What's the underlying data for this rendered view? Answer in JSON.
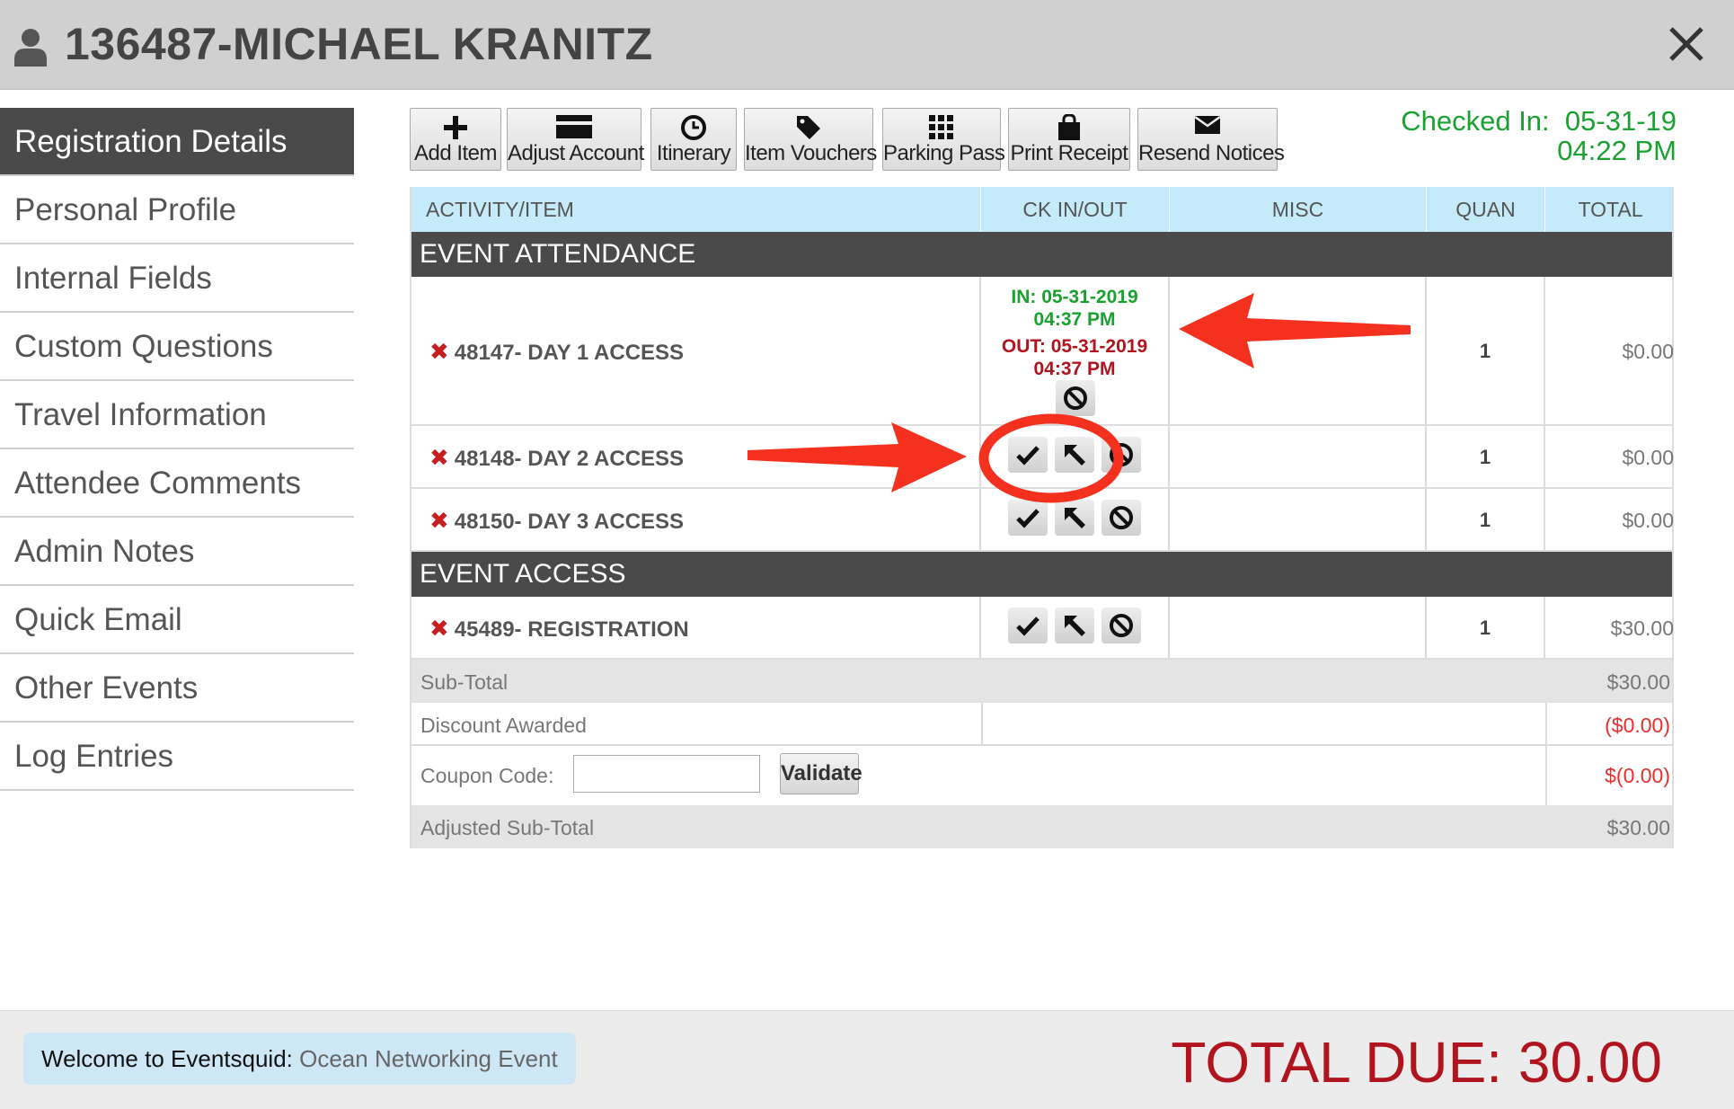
{
  "header": {
    "title": "136487-MICHAEL KRANITZ"
  },
  "sidebar": {
    "items": [
      {
        "label": "Registration Details",
        "active": true
      },
      {
        "label": "Personal Profile"
      },
      {
        "label": "Internal Fields"
      },
      {
        "label": "Custom Questions"
      },
      {
        "label": "Travel Information"
      },
      {
        "label": "Attendee Comments"
      },
      {
        "label": "Admin Notes"
      },
      {
        "label": "Quick Email"
      },
      {
        "label": "Other Events"
      },
      {
        "label": "Log Entries"
      }
    ]
  },
  "toolbar": {
    "add_item": "Add Item",
    "adjust_account": "Adjust Account",
    "itinerary": "Itinerary",
    "item_vouchers": "Item Vouchers",
    "parking_pass": "Parking Pass",
    "print_receipt": "Print Receipt",
    "resend_notices": "Resend Notices"
  },
  "checked_in": {
    "label": "Checked In:",
    "date": "05-31-19",
    "time": "04:22 PM"
  },
  "table": {
    "columns": [
      "ACTIVITY/ITEM",
      "CK IN/OUT",
      "MISC",
      "QUAN",
      "TOTAL"
    ],
    "sections": [
      {
        "title": "EVENT ATTENDANCE",
        "rows": [
          {
            "name": "48147- DAY 1 ACCESS",
            "in": "IN: 05-31-2019",
            "in_time": "04:37 PM",
            "out": "OUT: 05-31-2019",
            "out_time": "04:37 PM",
            "qty": "1",
            "total": "$0.00"
          },
          {
            "name": "48148- DAY 2 ACCESS",
            "qty": "1",
            "total": "$0.00"
          },
          {
            "name": "48150- DAY 3 ACCESS",
            "qty": "1",
            "total": "$0.00"
          }
        ]
      },
      {
        "title": "EVENT ACCESS",
        "rows": [
          {
            "name": "45489- REGISTRATION",
            "qty": "1",
            "total": "$30.00"
          }
        ]
      }
    ],
    "subtotal": {
      "label": "Sub-Total",
      "value": "$30.00"
    },
    "discount": {
      "label": "Discount Awarded",
      "value": "($0.00)"
    },
    "coupon": {
      "label": "Coupon Code:",
      "value": "",
      "button": "Validate",
      "amount": "$(0.00)"
    },
    "adjusted": {
      "label": "Adjusted Sub-Total",
      "value": "$30.00"
    }
  },
  "footer": {
    "welcome_label": "Welcome to Eventsquid:",
    "event_name": "Ocean Networking Event",
    "total_due": "TOTAL DUE: 30.00"
  },
  "colors": {
    "accent_green": "#1aa130",
    "accent_red": "#b0141e",
    "header_blue": "#c5eaf9",
    "annotation_red": "#f4301e"
  }
}
